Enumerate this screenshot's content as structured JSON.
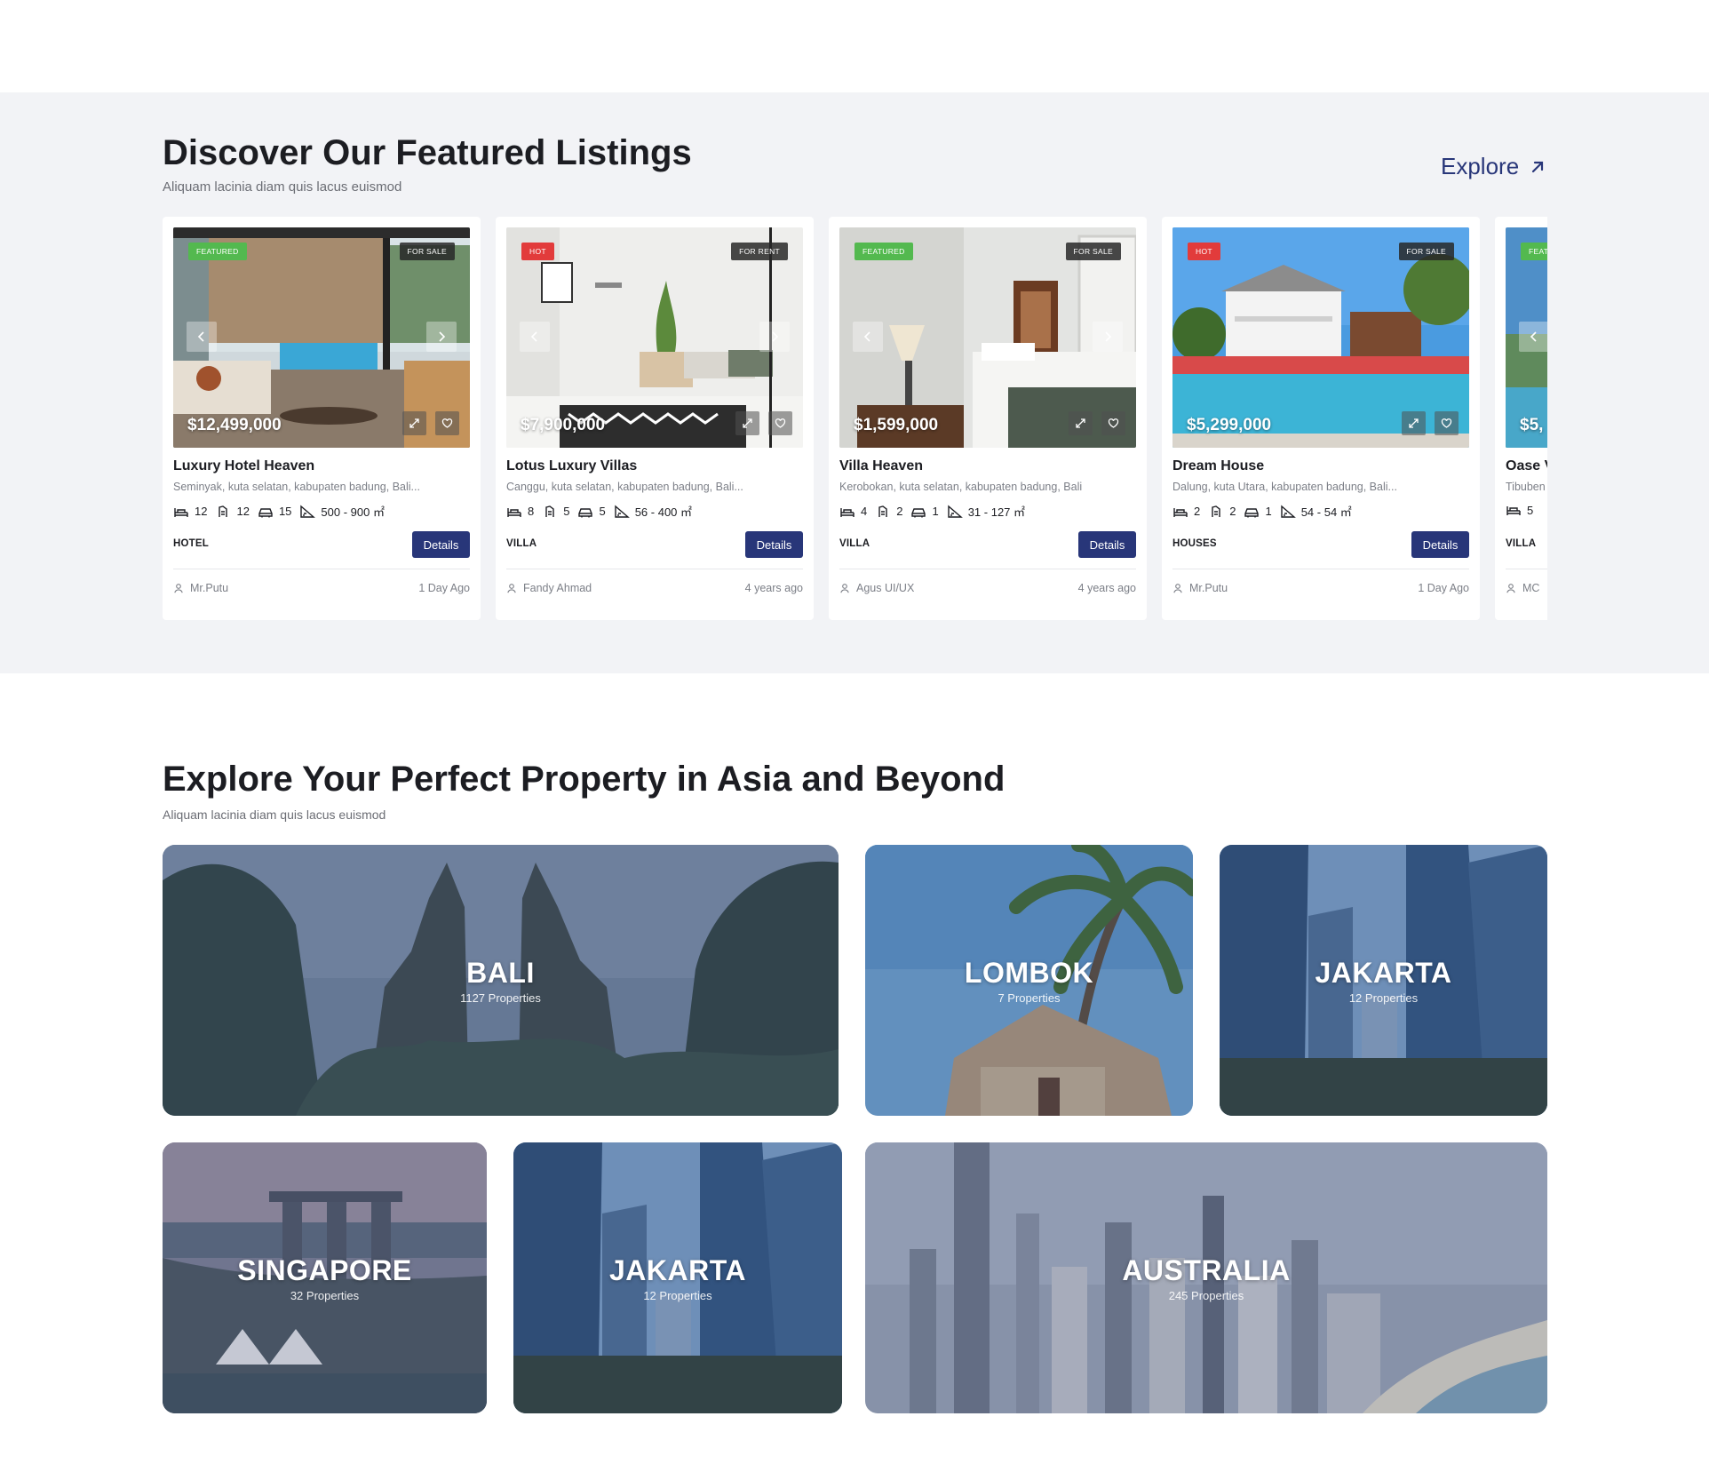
{
  "featured": {
    "title": "Discover Our Featured Listings",
    "subtitle": "Aliquam lacinia diam quis lacus euismod",
    "explore_label": "Explore",
    "listings": [
      {
        "badge_left": "FEATURED",
        "badge_left_color": "#53b94f",
        "badge_right": "FOR SALE",
        "price": "$12,499,000",
        "title": "Luxury Hotel Heaven",
        "address": "Seminyak, kuta selatan, kabupaten badung, Bali...",
        "beds": "12",
        "baths": "12",
        "garage": "15",
        "area": "500 - 900 ㎡",
        "type": "HOTEL",
        "details_label": "Details",
        "agent": "Mr.Putu",
        "time": "1 Day Ago"
      },
      {
        "badge_left": "HOT",
        "badge_left_color": "#e23b3b",
        "badge_right": "FOR RENT",
        "price": "$7,900,000",
        "title": "Lotus Luxury Villas",
        "address": "Canggu, kuta selatan, kabupaten badung, Bali...",
        "beds": "8",
        "baths": "5",
        "garage": "5",
        "area": "56 - 400 ㎡",
        "type": "VILLA",
        "details_label": "Details",
        "agent": "Fandy Ahmad",
        "time": "4 years ago"
      },
      {
        "badge_left": "FEATURED",
        "badge_left_color": "#53b94f",
        "badge_right": "FOR SALE",
        "price": "$1,599,000",
        "title": "Villa Heaven",
        "address": "Kerobokan, kuta selatan, kabupaten badung, Bali",
        "beds": "4",
        "baths": "2",
        "garage": "1",
        "area": "31 - 127 ㎡",
        "type": "VILLA",
        "details_label": "Details",
        "agent": "Agus UI/UX",
        "time": "4 years ago"
      },
      {
        "badge_left": "HOT",
        "badge_left_color": "#e23b3b",
        "badge_right": "FOR SALE",
        "price": "$5,299,000",
        "title": "Dream House",
        "address": "Dalung, kuta Utara, kabupaten badung, Bali...",
        "beds": "2",
        "baths": "2",
        "garage": "1",
        "area": "54 - 54 ㎡",
        "type": "HOUSES",
        "details_label": "Details",
        "agent": "Mr.Putu",
        "time": "1 Day Ago"
      },
      {
        "badge_left": "FEAT",
        "badge_left_color": "#53b94f",
        "price": "$5,",
        "title": "Oase V",
        "address": "Tibuben",
        "beds": "5",
        "type": "VILLA",
        "agent": "MC"
      }
    ]
  },
  "locations": {
    "title": "Explore Your Perfect Property in Asia and Beyond",
    "subtitle": "Aliquam lacinia diam quis lacus euismod",
    "items": [
      {
        "name": "BALI",
        "count": "1127 Properties"
      },
      {
        "name": "LOMBOK",
        "count": "7 Properties"
      },
      {
        "name": "JAKARTA",
        "count": "12 Properties"
      },
      {
        "name": "SINGAPORE",
        "count": "32 Properties"
      },
      {
        "name": "JAKARTA",
        "count": "12 Properties"
      },
      {
        "name": "AUSTRALIA",
        "count": "245 Properties"
      }
    ]
  },
  "icons": {
    "explore": "arrow-up-right-icon",
    "beds": "bed-icon",
    "baths": "bath-icon",
    "garage": "car-icon",
    "area": "area-ruler-icon",
    "agent": "user-icon",
    "prev": "chevron-left-icon",
    "next": "chevron-right-icon",
    "expand": "expand-icon",
    "favorite": "heart-icon"
  },
  "colors": {
    "primary": "#283679",
    "badge_featured": "#53b94f",
    "badge_hot": "#e23b3b",
    "band_background": "#f2f3f6"
  }
}
